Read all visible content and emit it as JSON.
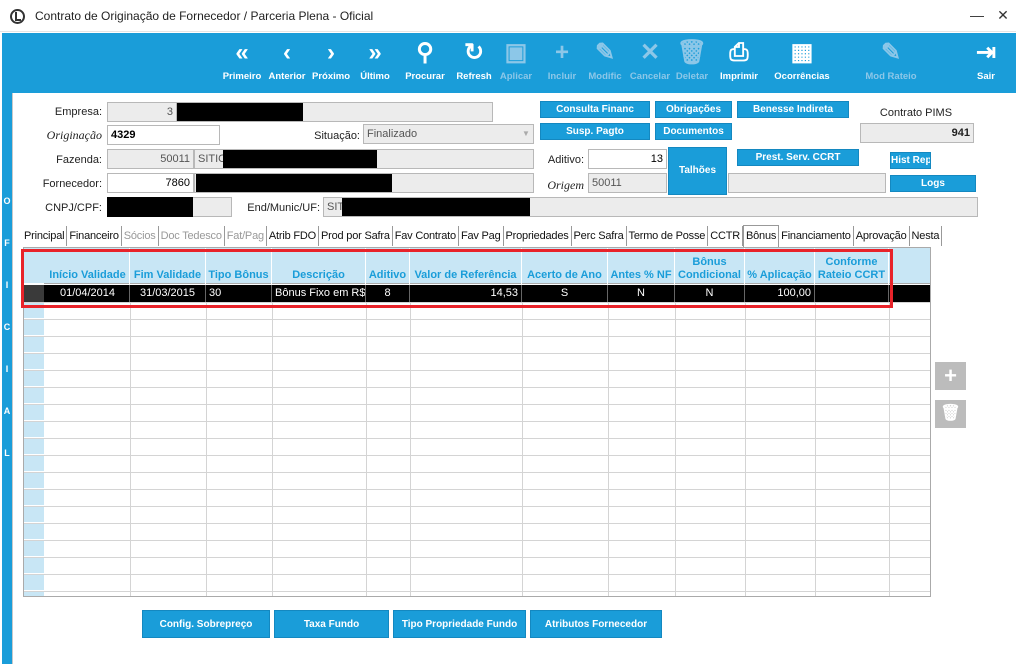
{
  "window": {
    "title": "Contrato de Originação de Fornecedor / Parceria Plena - Oficial",
    "minimize": "—",
    "maximize": "☐",
    "close": "✕"
  },
  "toolbar": [
    {
      "icon": "«",
      "label": "Primeiro",
      "enabled": true
    },
    {
      "icon": "‹",
      "label": "Anterior",
      "enabled": true
    },
    {
      "icon": "›",
      "label": "Próximo",
      "enabled": true
    },
    {
      "icon": "»",
      "label": "Último",
      "enabled": true
    },
    {
      "icon": "⚲",
      "label": "Procurar",
      "enabled": true
    },
    {
      "icon": "↻",
      "label": "Refresh",
      "enabled": true
    },
    {
      "icon": "▣",
      "label": "Aplicar",
      "enabled": false
    },
    {
      "icon": "+",
      "label": "Incluir",
      "enabled": false
    },
    {
      "icon": "✎",
      "label": "Modific",
      "enabled": false
    },
    {
      "icon": "✕",
      "label": "Cancelar",
      "enabled": false
    },
    {
      "icon": "🗑",
      "label": "Deletar",
      "enabled": false
    },
    {
      "icon": "⎙",
      "label": "Imprimir",
      "enabled": true
    },
    {
      "icon": "▦",
      "label": "Ocorrências",
      "enabled": true
    },
    {
      "icon": "✎",
      "label": "Mod Rateio",
      "enabled": false
    },
    {
      "icon": "⇥",
      "label": "Sair",
      "enabled": true
    }
  ],
  "side_letters": [
    "O",
    "F",
    "I",
    "C",
    "I",
    "A",
    "L"
  ],
  "form": {
    "empresa_label": "Empresa:",
    "empresa_value": "3",
    "originacao_label": "Originação",
    "originacao_value": "4329",
    "situacao_label": "Situação:",
    "situacao_value": "Finalizado",
    "fazenda_label": "Fazenda:",
    "fazenda_code": "50011",
    "fazenda_name_prefix": "SITIO",
    "aditivo_label": "Aditivo:",
    "aditivo_value": "13",
    "fornecedor_label": "Fornecedor:",
    "fornecedor_value": "7860",
    "origem_label": "Origem",
    "origem_value": "50011",
    "cnpj_label": "CNPJ/CPF:",
    "end_label": "End/Munic/UF:",
    "end_prefix": "SIT",
    "contrato_pims_label": "Contrato PIMS",
    "contrato_pims_value": "941"
  },
  "action_buttons": {
    "consulta_financ": "Consulta Financ",
    "obrigacoes": "Obrigações",
    "benesse_indireta": "Benesse Indireta",
    "susp_pagto": "Susp. Pagto",
    "documentos": "Documentos",
    "talhoes": "Talhões",
    "prest_serv_ccrt": "Prest. Serv. CCRT",
    "hist_repr": "Hist Repr",
    "logs": "Logs"
  },
  "tabs": [
    {
      "label": "Principal",
      "enabled": true,
      "active": false
    },
    {
      "label": "Financeiro",
      "enabled": true,
      "active": false
    },
    {
      "label": "Sócios",
      "enabled": false,
      "active": false
    },
    {
      "label": "Doc Tedesco",
      "enabled": false,
      "active": false
    },
    {
      "label": "Fat/Pag",
      "enabled": false,
      "active": false
    },
    {
      "label": "Atrib FDO",
      "enabled": true,
      "active": false
    },
    {
      "label": "Prod por Safra",
      "enabled": true,
      "active": false
    },
    {
      "label": "Fav Contrato",
      "enabled": true,
      "active": false
    },
    {
      "label": "Fav Pag",
      "enabled": true,
      "active": false
    },
    {
      "label": "Propriedades",
      "enabled": true,
      "active": false
    },
    {
      "label": "Perc Safra",
      "enabled": true,
      "active": false
    },
    {
      "label": "Termo de Posse",
      "enabled": true,
      "active": false
    },
    {
      "label": "CCTR",
      "enabled": true,
      "active": false
    },
    {
      "label": "Bônus",
      "enabled": true,
      "active": true
    },
    {
      "label": "Financiamento",
      "enabled": true,
      "active": false
    },
    {
      "label": "Aprovação",
      "enabled": true,
      "active": false
    },
    {
      "label": "Nesta",
      "enabled": true,
      "active": false
    }
  ],
  "grid": {
    "columns": [
      {
        "key": "inicio",
        "label": "Início Validade"
      },
      {
        "key": "fim",
        "label": "Fim Validade"
      },
      {
        "key": "tipo",
        "label": "Tipo Bônus"
      },
      {
        "key": "descricao",
        "label": "Descrição"
      },
      {
        "key": "aditivo",
        "label": "Aditivo"
      },
      {
        "key": "valor_ref",
        "label": "Valor de Referência"
      },
      {
        "key": "acerto",
        "label": "Acerto de Ano"
      },
      {
        "key": "antes_nf",
        "label": "Antes % NF"
      },
      {
        "key": "bonus_cond",
        "label": "Bônus Condicional"
      },
      {
        "key": "aplicacao",
        "label": "% Aplicação"
      },
      {
        "key": "rateio",
        "label": "Conforme Rateio CCRT"
      }
    ],
    "rows": [
      {
        "inicio": "01/04/2014",
        "fim": "31/03/2015",
        "tipo": "30",
        "descricao": "Bônus Fixo em R$",
        "aditivo": "8",
        "valor_ref": "14,53",
        "acerto": "S",
        "antes_nf": "N",
        "bonus_cond": "N",
        "aplicacao": "100,00",
        "rateio": ""
      }
    ]
  },
  "grid_side_buttons": {
    "add": "+",
    "delete": "🗑"
  },
  "footer_buttons": {
    "config_sobrepreco": "Config. Sobrepreço",
    "taxa_fundo": "Taxa Fundo",
    "tipo_propriedade_fundo": "Tipo Propriedade Fundo",
    "atributos_fornecedor": "Atributos Fornecedor"
  },
  "colors": {
    "accent": "#1a9dd9",
    "highlight": "#e8232a",
    "grid_header_bg": "#c8e6f5"
  }
}
